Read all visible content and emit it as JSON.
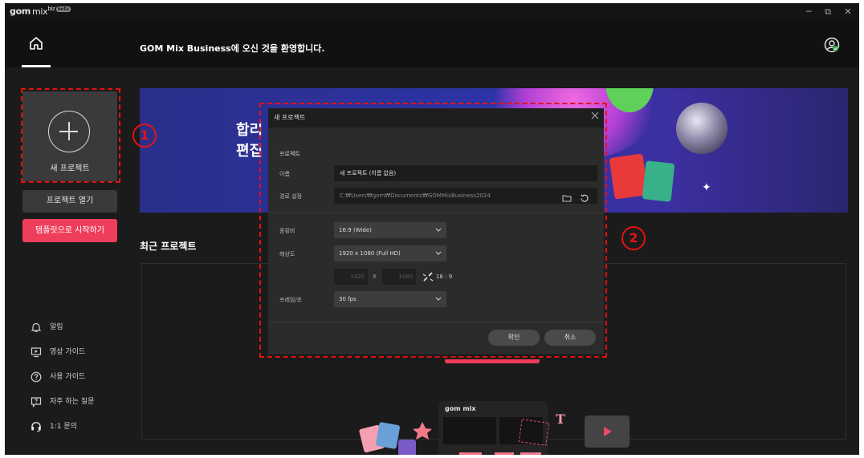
{
  "app": {
    "logo_brand": "gom",
    "logo_mix": "mix",
    "logo_biz": "biz",
    "logo_tag": "beta",
    "window_controls": {
      "minimize": "─",
      "restore": "⧉",
      "close": "✕"
    }
  },
  "header": {
    "welcome": "GOM Mix Business에 오신 것을 환영합니다."
  },
  "sidebar": {
    "new_project_label": "새 프로젝트",
    "open_project_label": "프로젝트 열기",
    "template_label": "템플릿으로 시작하기",
    "links": [
      {
        "label": "알림",
        "icon": "bell-icon"
      },
      {
        "label": "영상 가이드",
        "icon": "video-guide-icon"
      },
      {
        "label": "사용 가이드",
        "icon": "help-icon"
      },
      {
        "label": "자주 하는 질문",
        "icon": "faq-icon"
      },
      {
        "label": "1:1 문의",
        "icon": "headset-icon"
      }
    ]
  },
  "banner": {
    "text_line1": "합리",
    "text_line2": "편집"
  },
  "recent": {
    "title": "최근 프로젝트"
  },
  "dialog": {
    "title": "새 프로젝트",
    "section": "프로젝트",
    "name_label": "이름",
    "name_value": "새 프로젝트 (이름 없음)",
    "path_label": "경로 설정",
    "path_value": "C:₩Users₩gom₩Documents₩GOMMixBusiness2024",
    "ratio_label": "종횡비",
    "ratio_value": "16:9 (Wide)",
    "resolution_label": "해상도",
    "resolution_value": "1920 x 1080 (Full HD)",
    "width_value": "1920",
    "x_label": "X",
    "height_value": "1080",
    "aspect_readout": "16 : 9",
    "fps_label": "프레임/초",
    "fps_value": "30 fps",
    "ok_label": "확인",
    "cancel_label": "취소"
  },
  "annotations": {
    "marker1": "1",
    "marker2": "2",
    "color": "#e81010"
  },
  "colors": {
    "accent": "#ee3e5c",
    "background": "#1b1b1b",
    "header": "#111111",
    "dialog": "#2b2b2b"
  }
}
